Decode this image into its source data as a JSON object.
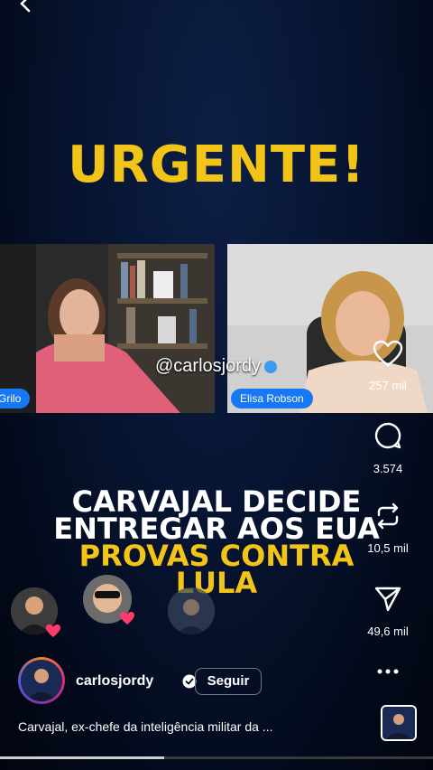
{
  "headline": "URGENTE!",
  "video": {
    "left_name_tag": "Grilo",
    "right_name_tag": "Elisa Robson",
    "handle": "@carlosjordy"
  },
  "caption_lines": {
    "line1": "CARVAJAL DECIDE",
    "line2": "ENTREGAR AOS EUA",
    "line3": "PROVAS CONTRA",
    "line4": "LULA"
  },
  "actions": {
    "likes": "257 mil",
    "comments": "3.574",
    "reposts": "10,5 mil",
    "shares": "49,6 mil"
  },
  "profile": {
    "username": "carlosjordy",
    "follow_label": "Seguir"
  },
  "description": "Carvajal, ex-chefe da inteligência militar da ...",
  "progress_fraction": 0.38,
  "colors": {
    "accent_yellow": "#f2c418",
    "tag_blue": "#1877f2",
    "heart_pink": "#ff3b6b"
  }
}
